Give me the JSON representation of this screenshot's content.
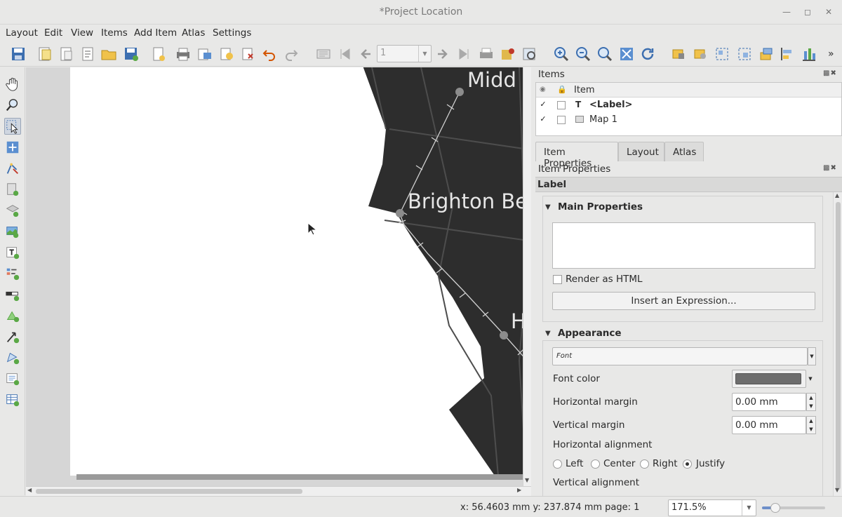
{
  "window": {
    "title": "*Project Location"
  },
  "menu": [
    "Layout",
    "Edit",
    "View",
    "Items",
    "Add Item",
    "Atlas",
    "Settings"
  ],
  "toolbar": {
    "page_value": "1"
  },
  "map": {
    "labels": [
      "Midd",
      "Brighton Be",
      "H"
    ]
  },
  "items_panel": {
    "title": "Items",
    "column": "Item",
    "rows": [
      {
        "name": "<Label>",
        "visible": true,
        "locked": false,
        "bold": true
      },
      {
        "name": "Map 1",
        "visible": true,
        "locked": false,
        "bold": false
      }
    ]
  },
  "tabs": [
    "Item Properties",
    "Layout",
    "Atlas"
  ],
  "properties": {
    "panel_title": "Item Properties",
    "item_type": "Label",
    "main_group": "Main Properties",
    "render_html": "Render as HTML",
    "insert_expression": "Insert an Expression...",
    "appearance_group": "Appearance",
    "font_button": "Font",
    "font_color_label": "Font color",
    "font_color": "#6d6d6d",
    "h_margin_label": "Horizontal margin",
    "h_margin_value": "0.00 mm",
    "v_margin_label": "Vertical margin",
    "v_margin_value": "0.00 mm",
    "h_align_label": "Horizontal alignment",
    "h_align_options": [
      "Left",
      "Center",
      "Right",
      "Justify"
    ],
    "h_align_selected": "Justify",
    "v_align_label": "Vertical alignment"
  },
  "status": {
    "coords": "x: 56.4603 mm  y: 237.874 mm  page: 1",
    "zoom": "171.5%"
  }
}
